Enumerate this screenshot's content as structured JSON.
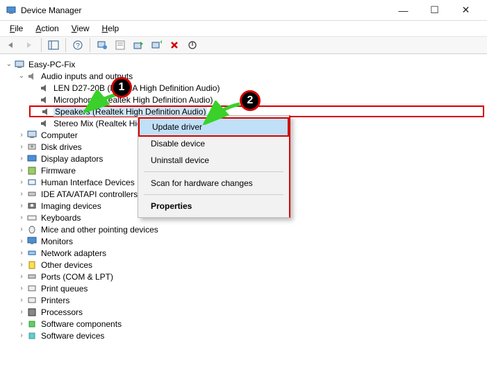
{
  "window": {
    "title": "Device Manager"
  },
  "menu": {
    "file": "File",
    "action": "Action",
    "view": "View",
    "help": "Help"
  },
  "tree": {
    "root": "Easy-PC-Fix",
    "audio_category": "Audio inputs and outputs",
    "audio_items": {
      "len": "LEN D27-20B (NVIDIA High Definition Audio)",
      "mic": "Microphone (Realtek High Definition Audio)",
      "speakers": "Speakers (Realtek High Definition Audio)",
      "stereo": "Stereo Mix (Realtek High Definition Audio)"
    },
    "categories": [
      "Computer",
      "Disk drives",
      "Display adaptors",
      "Firmware",
      "Human Interface Devices",
      "IDE ATA/ATAPI controllers",
      "Imaging devices",
      "Keyboards",
      "Mice and other pointing devices",
      "Monitors",
      "Network adapters",
      "Other devices",
      "Ports (COM & LPT)",
      "Print queues",
      "Printers",
      "Processors",
      "Software components",
      "Software devices"
    ]
  },
  "context_menu": {
    "update": "Update driver",
    "disable": "Disable device",
    "uninstall": "Uninstall device",
    "scan": "Scan for hardware changes",
    "properties": "Properties"
  },
  "annotations": {
    "badge1": "1",
    "badge2": "2"
  }
}
